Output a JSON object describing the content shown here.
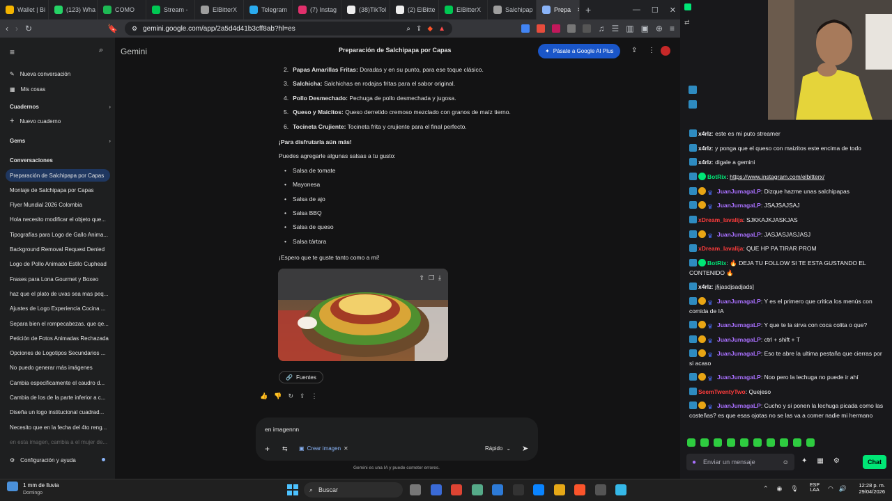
{
  "browser": {
    "tabs": [
      {
        "label": "Wallet | Bi",
        "color": "#f4b400"
      },
      {
        "label": "(123) Wha",
        "color": "#25d366"
      },
      {
        "label": "COMO",
        "color": "#1db954"
      },
      {
        "label": "Stream - ",
        "color": "#00c853"
      },
      {
        "label": "ElBitterX",
        "color": "#9e9e9e"
      },
      {
        "label": "Telegram",
        "color": "#2aabee"
      },
      {
        "label": "(7) Instag",
        "color": "#e1306c"
      },
      {
        "label": "(38)TikTol",
        "color": "#eeeeee"
      },
      {
        "label": "(2) ElBitte",
        "color": "#eeeeee"
      },
      {
        "label": "ElBitterX",
        "color": "#00c853"
      },
      {
        "label": "Salchipap",
        "color": "#9e9e9e"
      },
      {
        "label": "Prepa",
        "color": "#8ab4f8"
      }
    ],
    "url": "gemini.google.com/app/2a5d4d41b3cff8ab?hl=es"
  },
  "gemini": {
    "brand": "Gemini",
    "title": "Preparación de Salchipapa por Capas",
    "upgrade": "Pásate a Google AI Plus",
    "new_chat": "Nueva conversación",
    "my_stuff": "Mis cosas",
    "notebooks": "Cuadernos",
    "new_notebook": "Nuevo cuaderno",
    "gems": "Gems",
    "conversations_head": "Conversaciones",
    "conversations": [
      "Preparación de Salchipapa por Capas",
      "Montaje de Salchipapa por Capas",
      "Flyer Mundial 2026 Colombia",
      "Hola necesito modificar el objeto que...",
      "Tipografías para Logo de Gallo Anima...",
      "Background Removal Request Denied",
      "Logo de Pollo Animado Estilo Cuphead",
      "Frases para Lona Gourmet y Boxeo",
      "haz que el plato de uvas sea mas peq...",
      "Ajustes de Logo Experiencia Cocina ...",
      "Separa bien el rompecabezas. que qe...",
      "Petición de Fotos Animadas Rechazada",
      "Opciones de Logotipos Secundarios ...",
      "No puedo generar más imágenes",
      "Cambia especificamente el caudro d...",
      "Cambia de los de la parte inferior a c...",
      "Diseña un logo institucional cuadrad...",
      "Necesito que en la fecha del 4to reng...",
      "en esta imagen, cambia a el mujer de..."
    ],
    "settings": "Configuración y ayuda",
    "layers": [
      {
        "n": "2.",
        "b": "Papas Amarillas Fritas:",
        "t": " Doradas y en su punto, para ese toque clásico."
      },
      {
        "n": "3.",
        "b": "Salchicha:",
        "t": " Salchichas en rodajas fritas para el sabor original."
      },
      {
        "n": "4.",
        "b": "Pollo Desmechado:",
        "t": " Pechuga de pollo desmechada y jugosa."
      },
      {
        "n": "5.",
        "b": "Queso y Maicitos:",
        "t": " Queso derretido cremoso mezclado con granos de maíz tierno."
      },
      {
        "n": "6.",
        "b": "Tocineta Crujiente:",
        "t": " Tocineta frita y crujiente para el final perfecto."
      }
    ],
    "enjoy_heading": "¡Para disfrutarla aún más!",
    "sauces_intro": "Puedes agregarle algunas salsas a tu gusto:",
    "sauces": [
      "Salsa de tomate",
      "Mayonesa",
      "Salsa de ajo",
      "Salsa BBQ",
      "Salsa de queso",
      "Salsa tártara"
    ],
    "closing": "¡Espero que te guste tanto como a mí!",
    "sources": "Fuentes",
    "input_text": "en imagennn",
    "create_image": "Crear imagen",
    "mode": "Rápido",
    "disclaimer": "Gemini es una IA y puede cometer errores."
  },
  "chat": {
    "messages": [
      {
        "user": "x4rlz",
        "color": "#efeff1",
        "badges": [],
        "text": "este es mi puto streamer"
      },
      {
        "user": "x4rlz",
        "color": "#efeff1",
        "badges": [],
        "text": "y ponga que el queso con maizitos este encima de todo"
      },
      {
        "user": "x4rlz",
        "color": "#efeff1",
        "badges": [],
        "text": "digale a gemini"
      },
      {
        "user": "BotRix",
        "color": "#00e676",
        "badges": [
          "bot"
        ],
        "text": "https://www.instagram.com/elbitterx/"
      },
      {
        "user": "JuanJumagaLP",
        "color": "#a970ff",
        "badges": [
          "sub"
        ],
        "text": "Dizque hazme unas salchipapas"
      },
      {
        "user": "JuanJumagaLP",
        "color": "#a970ff",
        "badges": [
          "sub"
        ],
        "text": "JSAJSAJSAJ"
      },
      {
        "user": "xDream_lavalija",
        "color": "#ff3c3c",
        "badges": [],
        "text": "SJKKAJKJASKJAS"
      },
      {
        "user": "JuanJumagaLP",
        "color": "#a970ff",
        "badges": [
          "sub"
        ],
        "text": "JASJASJASJASJ"
      },
      {
        "user": "xDream_lavalija",
        "color": "#ff3c3c",
        "badges": [],
        "text": "QUE HP PA TIRAR PROM"
      },
      {
        "user": "BotRix",
        "color": "#00e676",
        "badges": [
          "bot"
        ],
        "text": "🔥 DEJA TU FOLLOW SI TE ESTA GUSTANDO EL CONTENIDO 🔥"
      },
      {
        "user": "x4rlz",
        "color": "#efeff1",
        "badges": [],
        "text": "j§jasdjsadjads]"
      },
      {
        "user": "JuanJumagaLP",
        "color": "#a970ff",
        "badges": [
          "sub"
        ],
        "text": "Y es el primero que critica los menús con comida de IA"
      },
      {
        "user": "JuanJumagaLP",
        "color": "#a970ff",
        "badges": [
          "sub"
        ],
        "text": "Y que te la sirva con coca colita o que?"
      },
      {
        "user": "JuanJumagaLP",
        "color": "#a970ff",
        "badges": [
          "sub"
        ],
        "text": "ctrl + shift + T"
      },
      {
        "user": "JuanJumagaLP",
        "color": "#a970ff",
        "badges": [
          "sub"
        ],
        "text": "Eso te abre la ultima pestaña que cierras por si acaso"
      },
      {
        "user": "JuanJumagaLP",
        "color": "#a970ff",
        "badges": [
          "sub"
        ],
        "text": "Noo pero la lechuga no puede ir ahí"
      },
      {
        "user": "SeemTwentyTwo",
        "color": "#ff3c3c",
        "badges": [],
        "text": "Quejeso"
      },
      {
        "user": "JuanJumagaLP",
        "color": "#a970ff",
        "badges": [
          "sub"
        ],
        "text": "Cucho y si ponen la lechuga picada como las costeñas? es que esas ojotas no se las va a comer nadie mi hermano"
      }
    ],
    "placeholder": "Enviar un mensaje",
    "chat_button": "Chat"
  },
  "taskbar": {
    "weather_temp": "1 mm de lluvia",
    "weather_day": "Domingo",
    "search": "Buscar",
    "lang1": "ESP",
    "lang2": "LAA",
    "time": "12:28 p. m.",
    "date": "29/04/2026"
  }
}
